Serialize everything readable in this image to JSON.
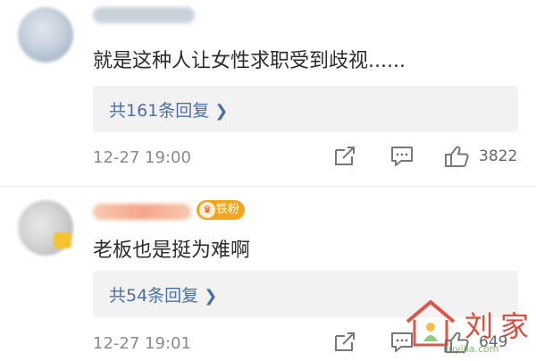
{
  "comments": [
    {
      "avatar_icon": "user-avatar",
      "body": "就是这种人让女性求职受到歧视......",
      "reply_link": "共161条回复",
      "timestamp": "12-27 19:00",
      "like_count": "3822"
    },
    {
      "avatar_icon": "user-avatar",
      "fan_badge": "铁粉",
      "body": "老板也是挺为难啊",
      "reply_link": "共54条回复",
      "timestamp": "12-27 19:01",
      "like_count": "649"
    }
  ],
  "icons": {
    "share": "share-icon",
    "comment": "comment-icon",
    "like": "thumbs-up-icon",
    "chevron": "chevron-right-icon"
  },
  "watermark": {
    "text": "刘家",
    "url": "liuyijia.com"
  },
  "colors": {
    "link": "#4d6fa8",
    "meta": "#8a8a8a",
    "reply_bg": "#f2f2f2",
    "badge": "#f6a41c",
    "watermark": "#d93a2b"
  }
}
